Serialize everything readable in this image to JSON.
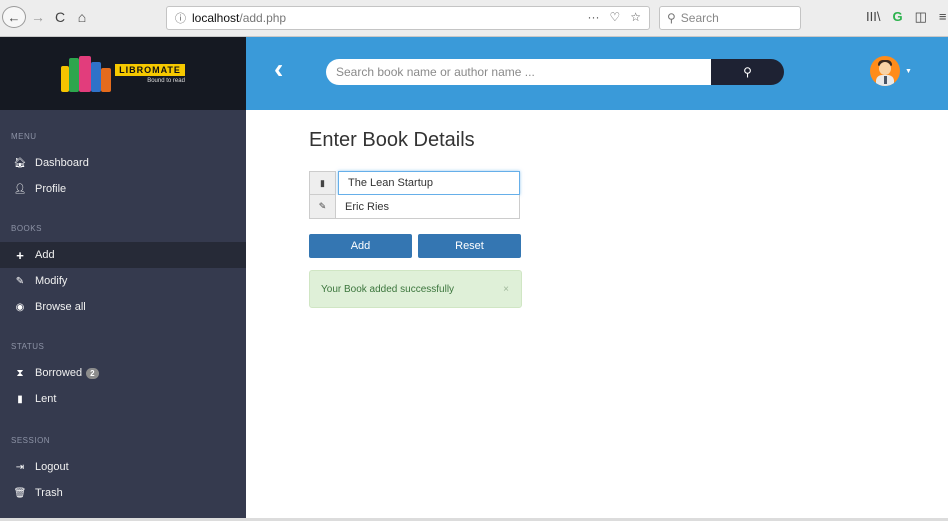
{
  "browser": {
    "back_glyph": "←",
    "forward_glyph": "→",
    "reload_glyph": "C",
    "home_glyph": "⌂",
    "url_host": "localhost",
    "url_path": "/add.php",
    "search_placeholder": "Search",
    "url_actions": [
      "···",
      "♡",
      "☆"
    ],
    "toolbar_icons": [
      "III\\",
      "G",
      "◫",
      "≡"
    ]
  },
  "logo": {
    "name": "LIBROMATE",
    "tagline": "Bound to read"
  },
  "sidebar": {
    "sections": {
      "menu": "MENU",
      "books": "BOOKS",
      "status": "STATUS",
      "session": "SESSION"
    },
    "items": {
      "dashboard": "Dashboard",
      "profile": "Profile",
      "add": "Add",
      "modify": "Modify",
      "browse_all": "Browse all",
      "borrowed": "Borrowed",
      "borrowed_count": "2",
      "lent": "Lent",
      "logout": "Logout",
      "trash": "Trash"
    }
  },
  "header": {
    "search_placeholder": "Search book name or author name ...",
    "search_button_icon": "search-icon"
  },
  "main": {
    "title": "Enter Book Details",
    "book_name_value": "The Lean Startup",
    "author_value": "Eric Ries",
    "add_label": "Add",
    "reset_label": "Reset",
    "alert_text": "Your Book added successfully",
    "alert_close": "×"
  },
  "colors": {
    "header_blue": "#3a9ad9",
    "sidebar_bg": "#353a4e",
    "logo_bg": "#151922",
    "button_blue": "#3476b2",
    "alert_green_bg": "#dff0d8",
    "alert_green_text": "#3c763d"
  }
}
